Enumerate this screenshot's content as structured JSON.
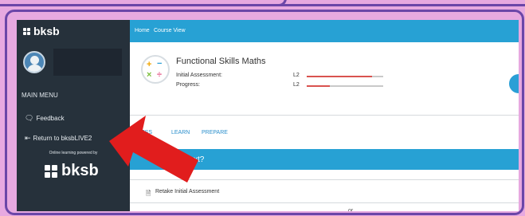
{
  "app": {
    "logo_text": "bksb"
  },
  "sidebar": {
    "menu_title": "MAIN MENU",
    "items": [
      {
        "label": "Feedback",
        "icon": "chat-search-icon",
        "glyph": "🗨"
      },
      {
        "label": "Return to bksbLIVE2",
        "icon": "return-arrow-icon",
        "glyph": "⇤"
      }
    ],
    "powered_by": "Online learning powered by",
    "bottom_logo_text": "bksb"
  },
  "topbar": {
    "crumbs": [
      "Home",
      "Course View"
    ]
  },
  "course": {
    "title": "Functional Skills Maths",
    "rows": [
      {
        "label": "Initial Assessment:",
        "level": "L2",
        "progress": 0.85
      },
      {
        "label": "Progress:",
        "level": "L2",
        "progress": 0.3
      }
    ],
    "icon_symbols": [
      "+",
      "−",
      "×",
      "÷"
    ]
  },
  "tabs": [
    "ASSESS",
    "LEARN",
    "PREPARE"
  ],
  "next_banner": "do next?",
  "actions": {
    "retake_label": "Retake Initial Assessment",
    "retake_glyph": "🗎",
    "or_text": "or"
  },
  "colors": {
    "accent": "#27a1d4",
    "sidebar": "#26313b",
    "arrow": "#e11d1d",
    "frame": "#e7a9e0"
  }
}
